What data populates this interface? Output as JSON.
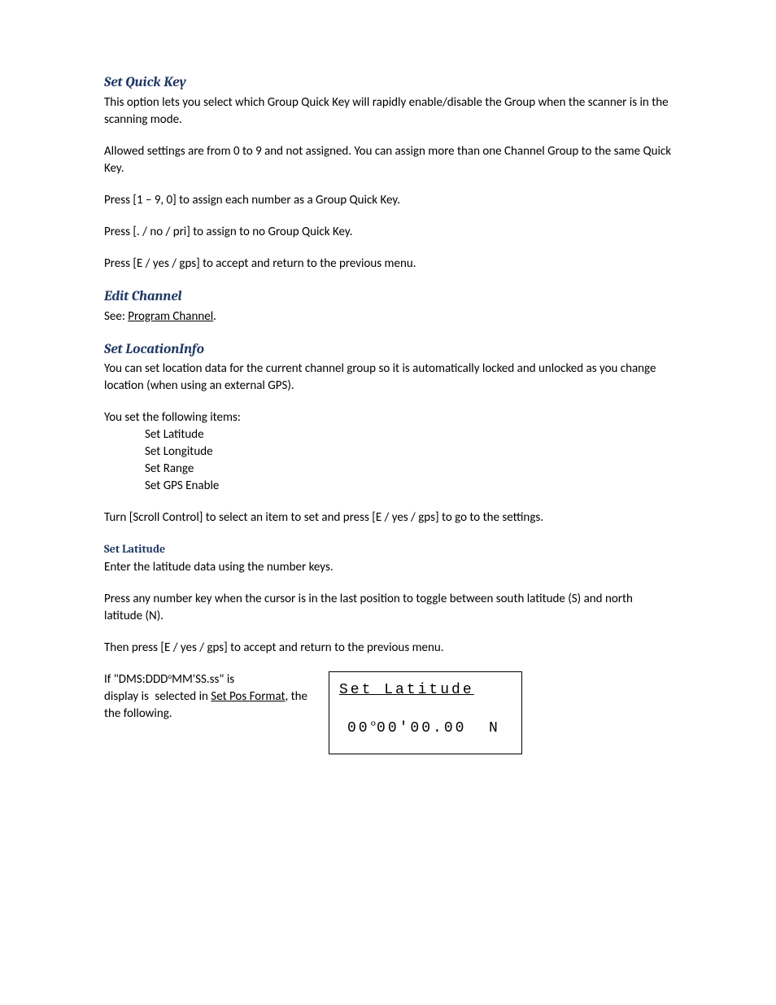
{
  "sections": {
    "setQuickKey": {
      "heading": "Set Quick Key",
      "p1": "This option lets you select which Group Quick Key will rapidly enable/disable the Group when the scanner is in the scanning mode.",
      "p2": "Allowed settings are from 0 to 9 and not assigned. You can assign more than one Channel Group to the same Quick Key.",
      "p3": "Press [1 – 9, 0] to assign each number as a Group Quick Key.",
      "p4": "Press [. / no / pri] to assign to no Group Quick Key.",
      "p5": "Press [E / yes / gps] to accept and return to the previous menu."
    },
    "editChannel": {
      "heading": "Edit Channel",
      "seePrefix": "See: ",
      "seeLink": "Program Channel",
      "seeSuffix": "."
    },
    "setLocationInfo": {
      "heading": "Set LocationInfo",
      "p1": "You can set location data for the current channel group so it is automatically locked and unlocked as you change location (when using an external GPS).",
      "introLine": "You set the following items:",
      "items": [
        "Set Latitude",
        "Set Longitude",
        "Set Range",
        "Set GPS Enable"
      ],
      "p2": "Turn [Scroll Control] to select an item to set and press [E / yes / gps] to go to the settings."
    },
    "setLatitude": {
      "heading": "Set Latitude",
      "p1": "Enter the latitude data using the number keys.",
      "p2": "Press any number key when the cursor is in the last position to toggle between south latitude (S) and north latitude (N).",
      "p3": "Then press [E / yes / gps] to accept and return to the previous menu.",
      "dmsPrefix": "If \"DMS:DDD",
      "dmsSuffix": "MM'SS.ss\" is",
      "selectedText": "selected in ",
      "linkText": "Set Pos Format",
      "afterLink": ", the",
      "trailing": "display is the following.",
      "lcd": {
        "title": "Set Latitude",
        "deg": "00",
        "min": "00'",
        "sec": "00.00",
        "hemi": "N"
      }
    }
  }
}
